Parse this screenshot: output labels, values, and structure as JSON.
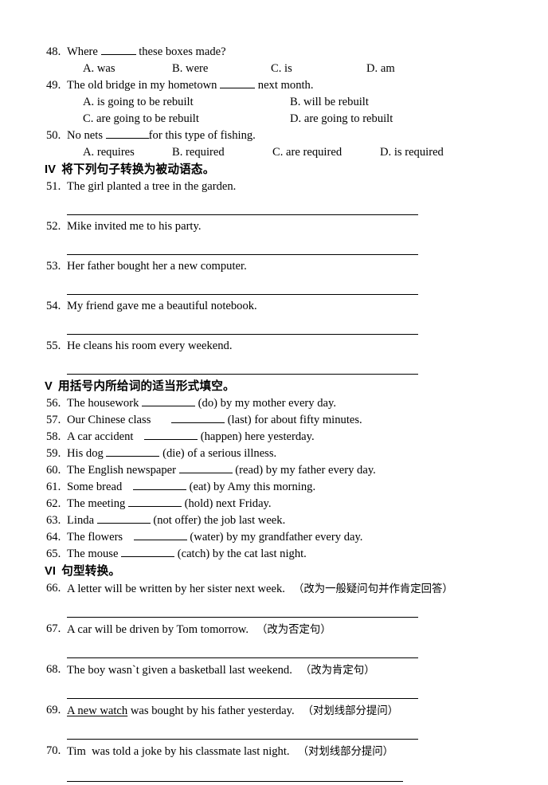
{
  "document": {
    "type": "english-grammar-worksheet",
    "topic": "passive-voice"
  },
  "multiple_choice": {
    "questions": [
      {
        "num": "48.",
        "stem_before": "Where ",
        "stem_after": " these boxes made?",
        "layout": "4col",
        "options": [
          "A. was",
          "B. were",
          "C. is",
          "D. am"
        ]
      },
      {
        "num": "49.",
        "stem_before": "The old bridge in my hometown ",
        "stem_after": " next month.",
        "layout": "2col",
        "options": [
          "A. is going to be rebuilt",
          "B. will be rebuilt",
          "C. are going to be rebuilt",
          "D. are going to rebuilt"
        ]
      },
      {
        "num": "50.",
        "stem_before": "No nets ",
        "stem_after": "for this type of fishing.",
        "layout": "4col",
        "options": [
          "A. requires",
          "B. required",
          "C. are required",
          "D. is required"
        ]
      }
    ]
  },
  "section_iv": {
    "numeral": "IV",
    "title": "将下列句子转换为被动语态。",
    "items": [
      {
        "num": "51.",
        "text": "The girl planted a tree in the garden."
      },
      {
        "num": "52.",
        "text": "Mike invited me to his party."
      },
      {
        "num": "53.",
        "text": "Her father bought her a new computer."
      },
      {
        "num": "54.",
        "text": "My friend gave me a beautiful notebook."
      },
      {
        "num": "55.",
        "text": "He cleans his room every weekend."
      }
    ]
  },
  "section_v": {
    "numeral": "V",
    "title": "用括号内所给词的适当形式填空。",
    "items": [
      {
        "num": "56.",
        "before": "The housework ",
        "after": " (do) by my mother every day."
      },
      {
        "num": "57.",
        "before": "Our Chinese class ",
        "after": " (last) for about fifty minutes."
      },
      {
        "num": "58.",
        "before": "A car accident ",
        "after": " (happen) here yesterday."
      },
      {
        "num": "59.",
        "before": "His dog ",
        "after": " (die) of a serious illness."
      },
      {
        "num": "60.",
        "before": "The English newspaper ",
        "after": " (read) by my father every day."
      },
      {
        "num": "61.",
        "before": "Some bread ",
        "after": " (eat) by Amy this morning."
      },
      {
        "num": "62.",
        "before": "The meeting ",
        "after": " (hold) next Friday."
      },
      {
        "num": "63.",
        "before": "Linda ",
        "after": " (not offer) the job last week."
      },
      {
        "num": "64.",
        "before": "The flowers ",
        "after": " (water) by my grandfather every day."
      },
      {
        "num": "65.",
        "before": "The mouse ",
        "after": " (catch) by the cat last night."
      }
    ]
  },
  "section_vi": {
    "numeral": "VI",
    "title": "句型转换。",
    "items": [
      {
        "num": "66.",
        "sentence": "A letter will be written by her sister next week.",
        "instruction": "（改为一般疑问句并作肯定回答）"
      },
      {
        "num": "67.",
        "sentence": "A car will be driven by Tom tomorrow.",
        "instruction": "（改为否定句）"
      },
      {
        "num": "68.",
        "sentence": "The boy wasn`t given a basketball last weekend.",
        "instruction": "（改为肯定句）"
      },
      {
        "num": "69.",
        "underlined": "A new watch",
        "sentence": " was bought by his father yesterday.",
        "instruction": "（对划线部分提问）"
      },
      {
        "num": "70.",
        "sentence": "Tim  was told a joke by his classmate last night.",
        "instruction": "（对划线部分提问）"
      }
    ]
  }
}
